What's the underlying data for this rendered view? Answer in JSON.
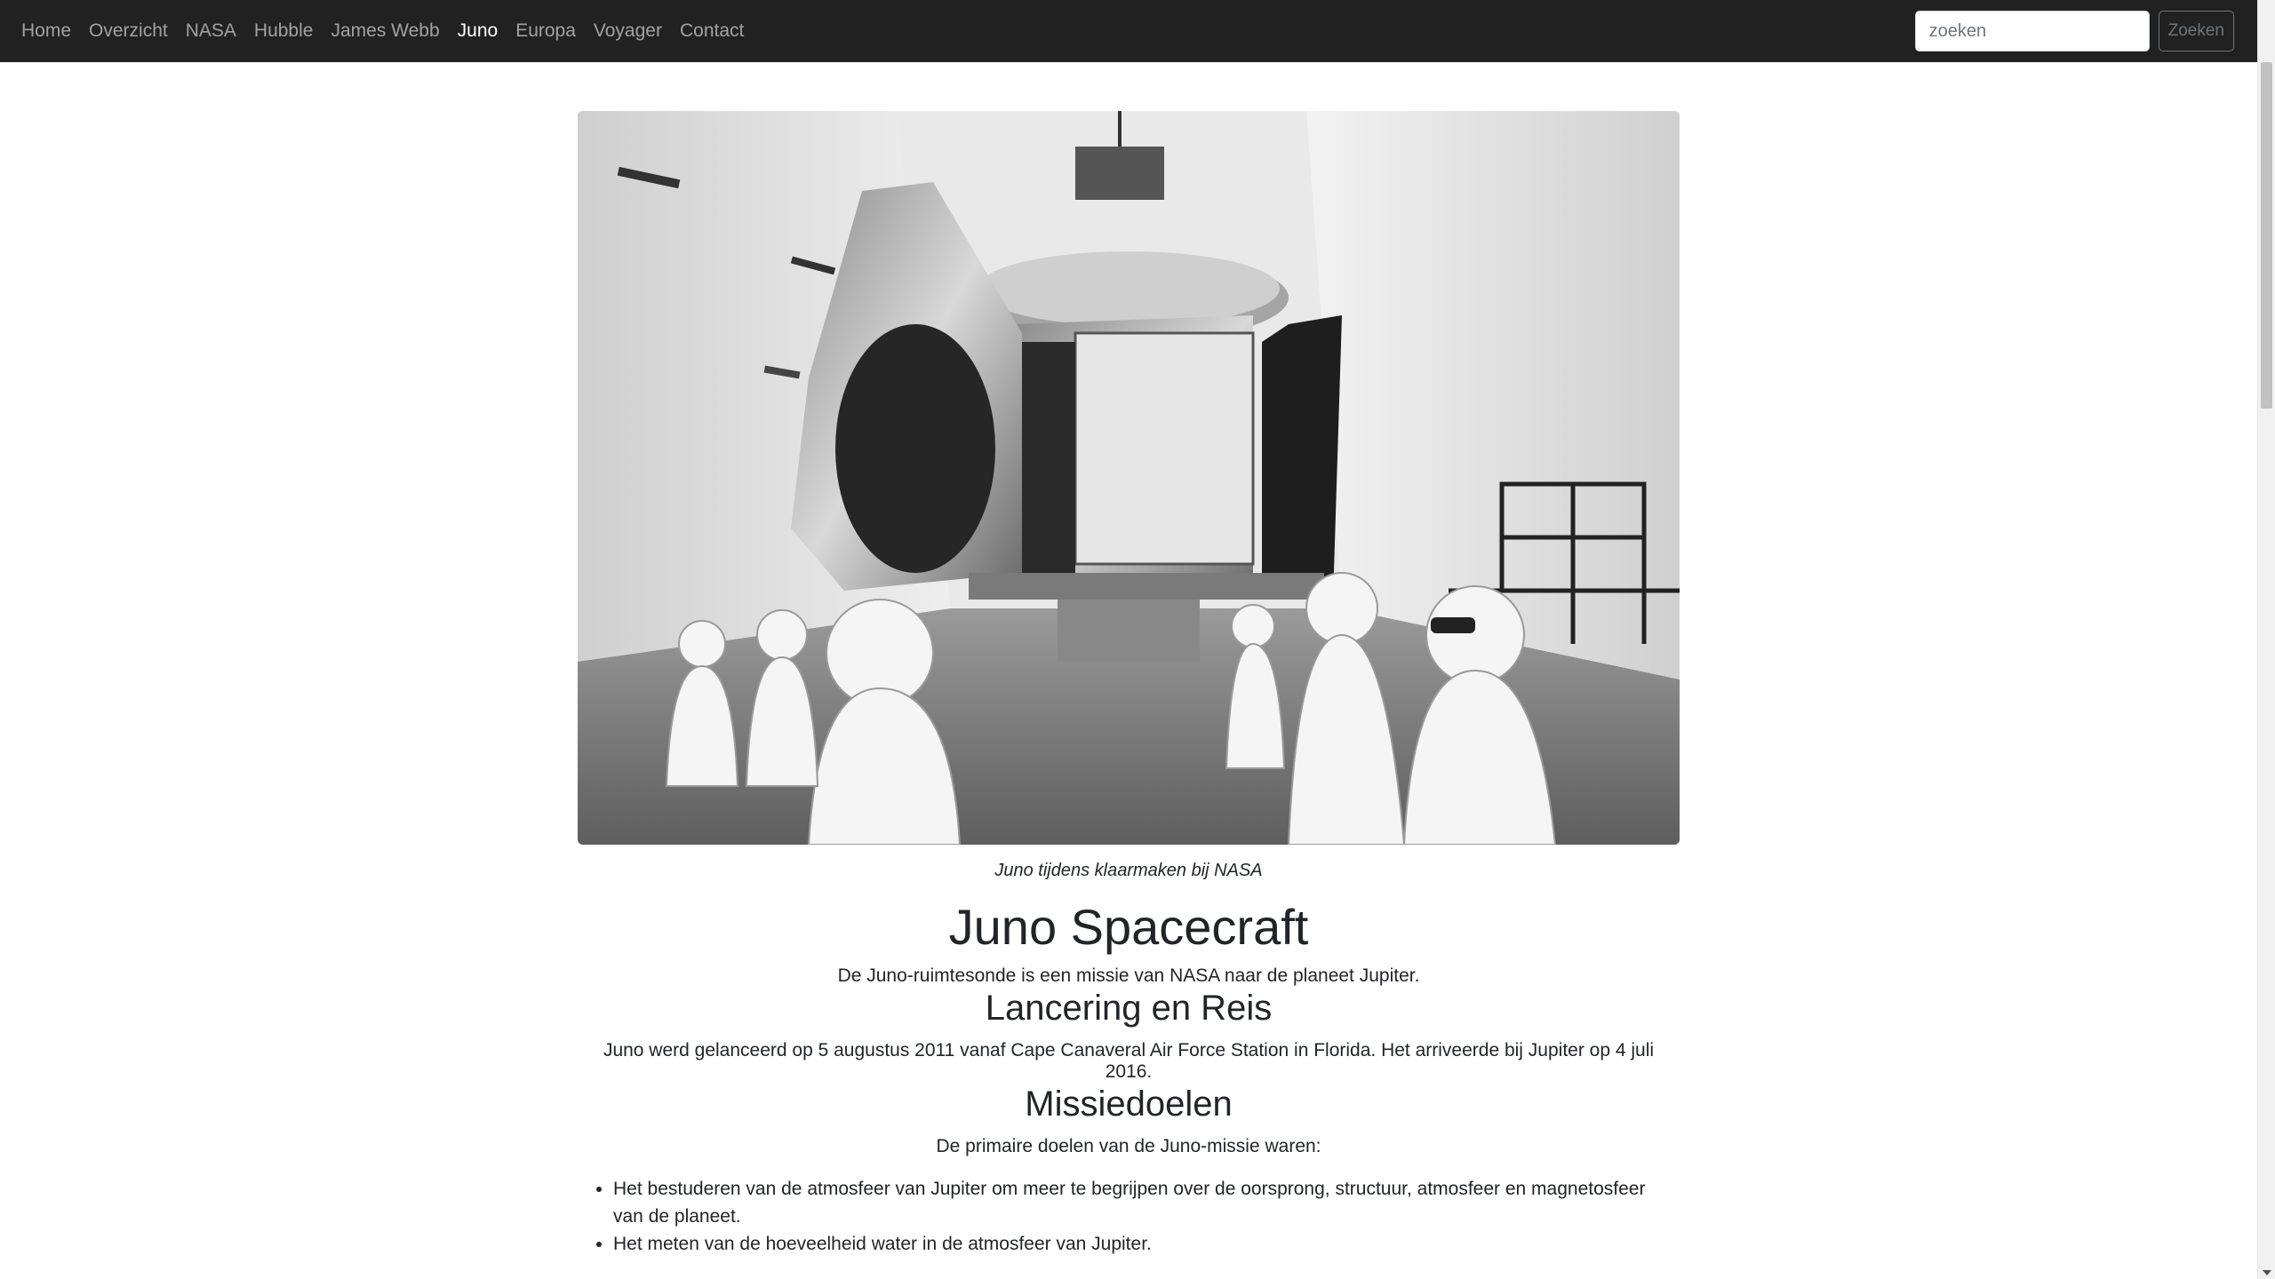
{
  "nav": {
    "items": [
      {
        "label": "Home",
        "active": false
      },
      {
        "label": "Overzicht",
        "active": false
      },
      {
        "label": "NASA",
        "active": false
      },
      {
        "label": "Hubble",
        "active": false
      },
      {
        "label": "James Webb",
        "active": false
      },
      {
        "label": "Juno",
        "active": true
      },
      {
        "label": "Europa",
        "active": false
      },
      {
        "label": "Voyager",
        "active": false
      },
      {
        "label": "Contact",
        "active": false
      }
    ],
    "search_placeholder": "zoeken",
    "search_button": "Zoeken"
  },
  "figure": {
    "caption": "Juno tijdens klaarmaken bij NASA"
  },
  "title": "Juno Spacecraft",
  "lead": "De Juno-ruimtesonde is een missie van NASA naar de planeet Jupiter.",
  "sections": [
    {
      "heading": "Lancering en Reis",
      "text": "Juno werd gelanceerd op 5 augustus 2011 vanaf Cape Canaveral Air Force Station in Florida. Het arriveerde bij Jupiter op 4 juli 2016."
    },
    {
      "heading": "Missiedoelen",
      "text": "De primaire doelen van de Juno-missie waren:",
      "goals": [
        "Het bestuderen van de atmosfeer van Jupiter om meer te begrijpen over de oorsprong, structuur, atmosfeer en magnetosfeer van de planeet.",
        "Het meten van de hoeveelheid water in de atmosfeer van Jupiter."
      ]
    }
  ]
}
